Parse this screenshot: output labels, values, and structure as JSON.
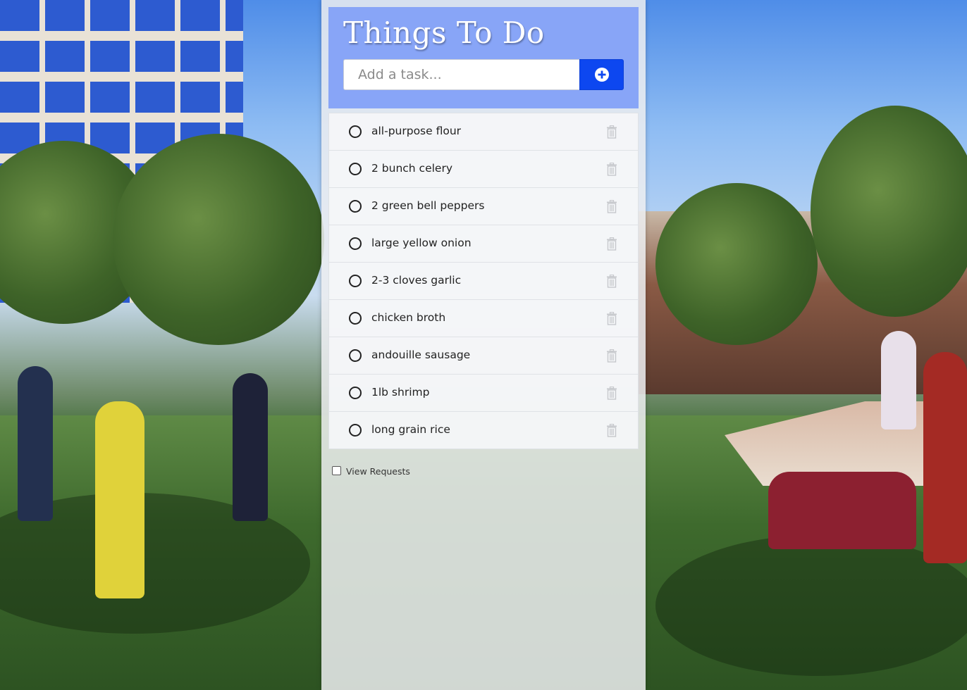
{
  "app": {
    "title": "Things To Do"
  },
  "add_task": {
    "placeholder": "Add a task...",
    "value": "",
    "button_icon": "plus-circle-icon"
  },
  "tasks": [
    {
      "label": "all-purpose flour",
      "completed": false
    },
    {
      "label": "2 bunch celery",
      "completed": false
    },
    {
      "label": "2 green bell peppers",
      "completed": false
    },
    {
      "label": "large yellow onion",
      "completed": false
    },
    {
      "label": "2-3 cloves garlic",
      "completed": false
    },
    {
      "label": "chicken broth",
      "completed": false
    },
    {
      "label": "andouille sausage",
      "completed": false
    },
    {
      "label": "1lb shrimp",
      "completed": false
    },
    {
      "label": "long grain rice",
      "completed": false
    }
  ],
  "view_requests": {
    "label": "View Requests",
    "checked": false
  },
  "colors": {
    "header_bg": "#88a5f7",
    "add_button_bg": "#0d47f0",
    "panel_bg": "#eceef0"
  },
  "icons": {
    "task_toggle": "circle-outline-icon",
    "task_delete": "trash-icon"
  }
}
